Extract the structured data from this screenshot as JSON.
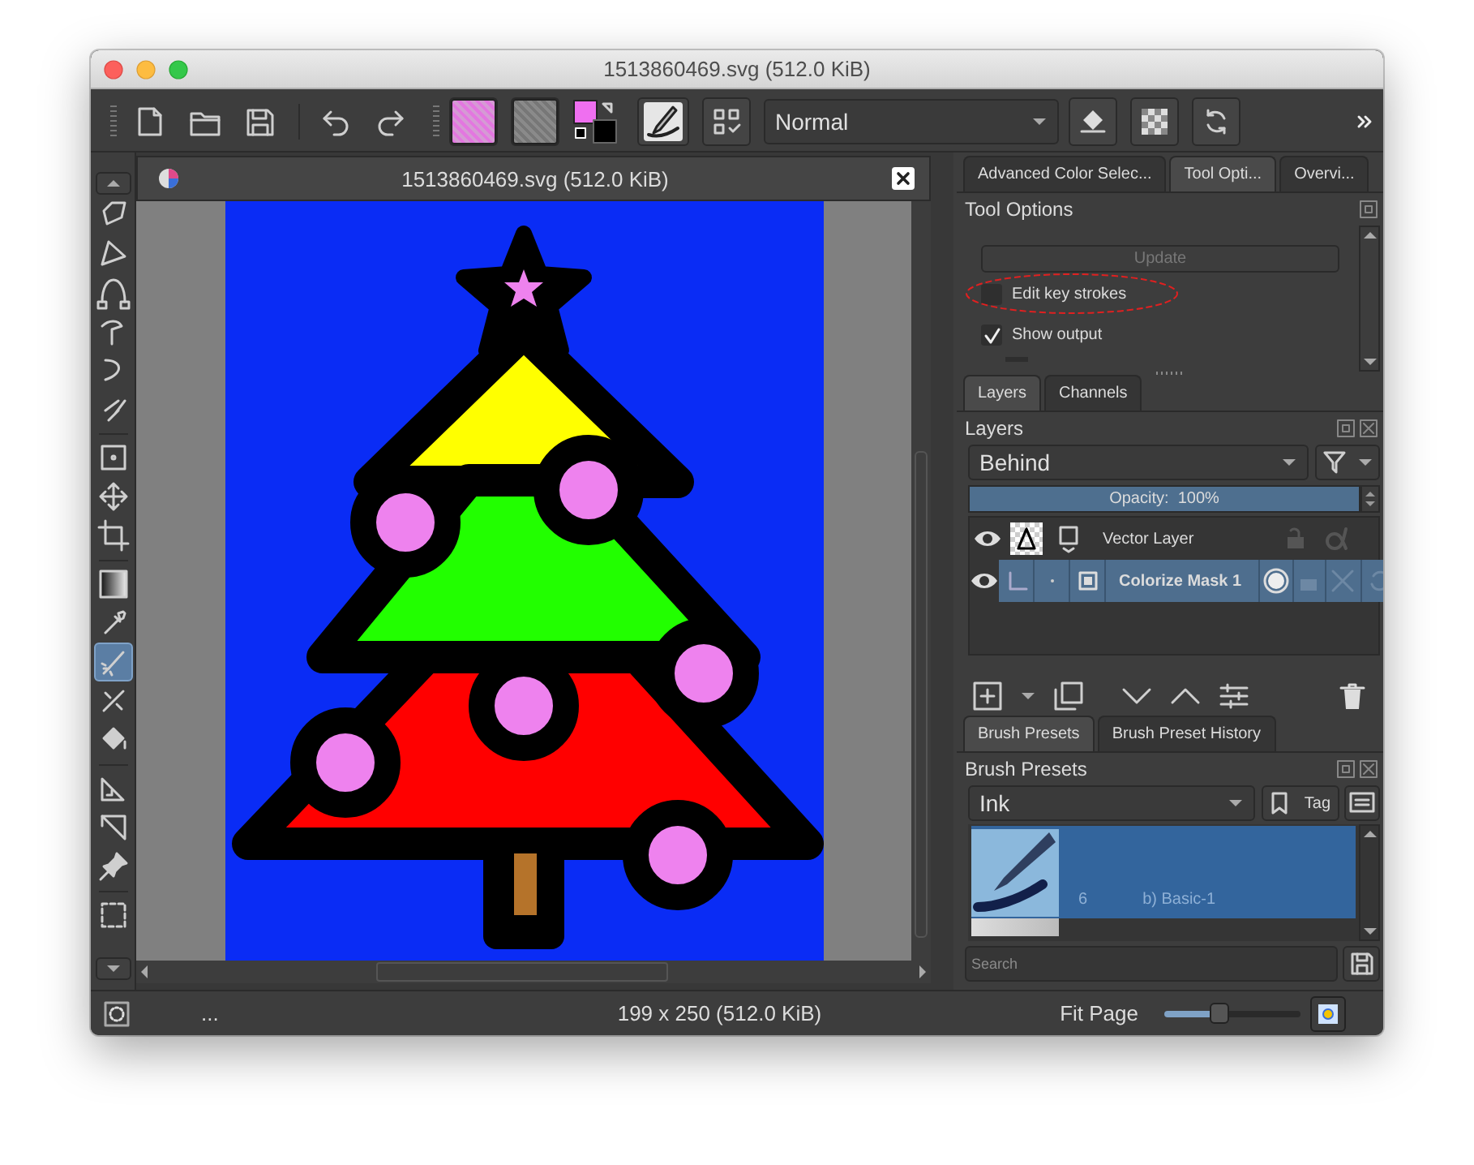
{
  "window": {
    "title": "1513860469.svg (512.0 KiB)"
  },
  "toolbar": {
    "blend_mode": "Normal"
  },
  "toolbox": {
    "tools": [
      {
        "selected": false
      },
      {
        "selected": false
      },
      {
        "selected": false
      },
      {
        "selected": false
      },
      {
        "selected": false
      },
      {
        "selected": false
      },
      {
        "selected": false
      },
      {
        "selected": false
      },
      {
        "selected": false
      },
      {
        "selected": false
      },
      {
        "selected": false
      },
      {
        "selected": true
      },
      {
        "selected": false
      },
      {
        "selected": false
      },
      {
        "selected": false
      },
      {
        "selected": false
      },
      {
        "selected": false
      },
      {
        "selected": false
      }
    ]
  },
  "document": {
    "title": "1513860469.svg (512.0 KiB)"
  },
  "tool_options": {
    "tabs": [
      {
        "label": "Advanced Color Selec...",
        "selected": false
      },
      {
        "label": "Tool Opti...",
        "selected": true
      },
      {
        "label": "Overvi...",
        "selected": false
      }
    ],
    "title": "Tool Options",
    "update_button": {
      "label": "Update",
      "disabled": true
    },
    "options": [
      {
        "label": "Edit key strokes",
        "checked": false,
        "highlighted": true
      },
      {
        "label": "Show output",
        "checked": true,
        "highlighted": false
      }
    ]
  },
  "layers": {
    "tabs": [
      {
        "label": "Layers",
        "selected": true
      },
      {
        "label": "Channels",
        "selected": false
      }
    ],
    "title": "Layers",
    "blend_mode": "Behind",
    "opacity": {
      "label": "Opacity:  100%",
      "level": 1
    },
    "items": [
      {
        "name": "Vector Layer",
        "kind": "vector",
        "visible": true,
        "selected": false
      },
      {
        "name": "Colorize Mask 1",
        "kind": "colorize_mask",
        "visible": true,
        "selected": true
      }
    ]
  },
  "brush_presets": {
    "tabs": [
      {
        "label": "Brush Presets",
        "selected": true
      },
      {
        "label": "Brush Preset History",
        "selected": false
      }
    ],
    "title": "Brush Presets",
    "tag": "Ink",
    "tag_button": "Tag",
    "presets": [
      {
        "number": "6",
        "name": "b) Basic-1",
        "selected": true
      }
    ],
    "search": {
      "placeholder": "Search"
    }
  },
  "status_bar": {
    "selection_info": "...",
    "image_info": "199 x 250 (512.0 KiB)",
    "zoom_mode": "Fit Page",
    "zoom": {
      "level": 0.4
    }
  }
}
